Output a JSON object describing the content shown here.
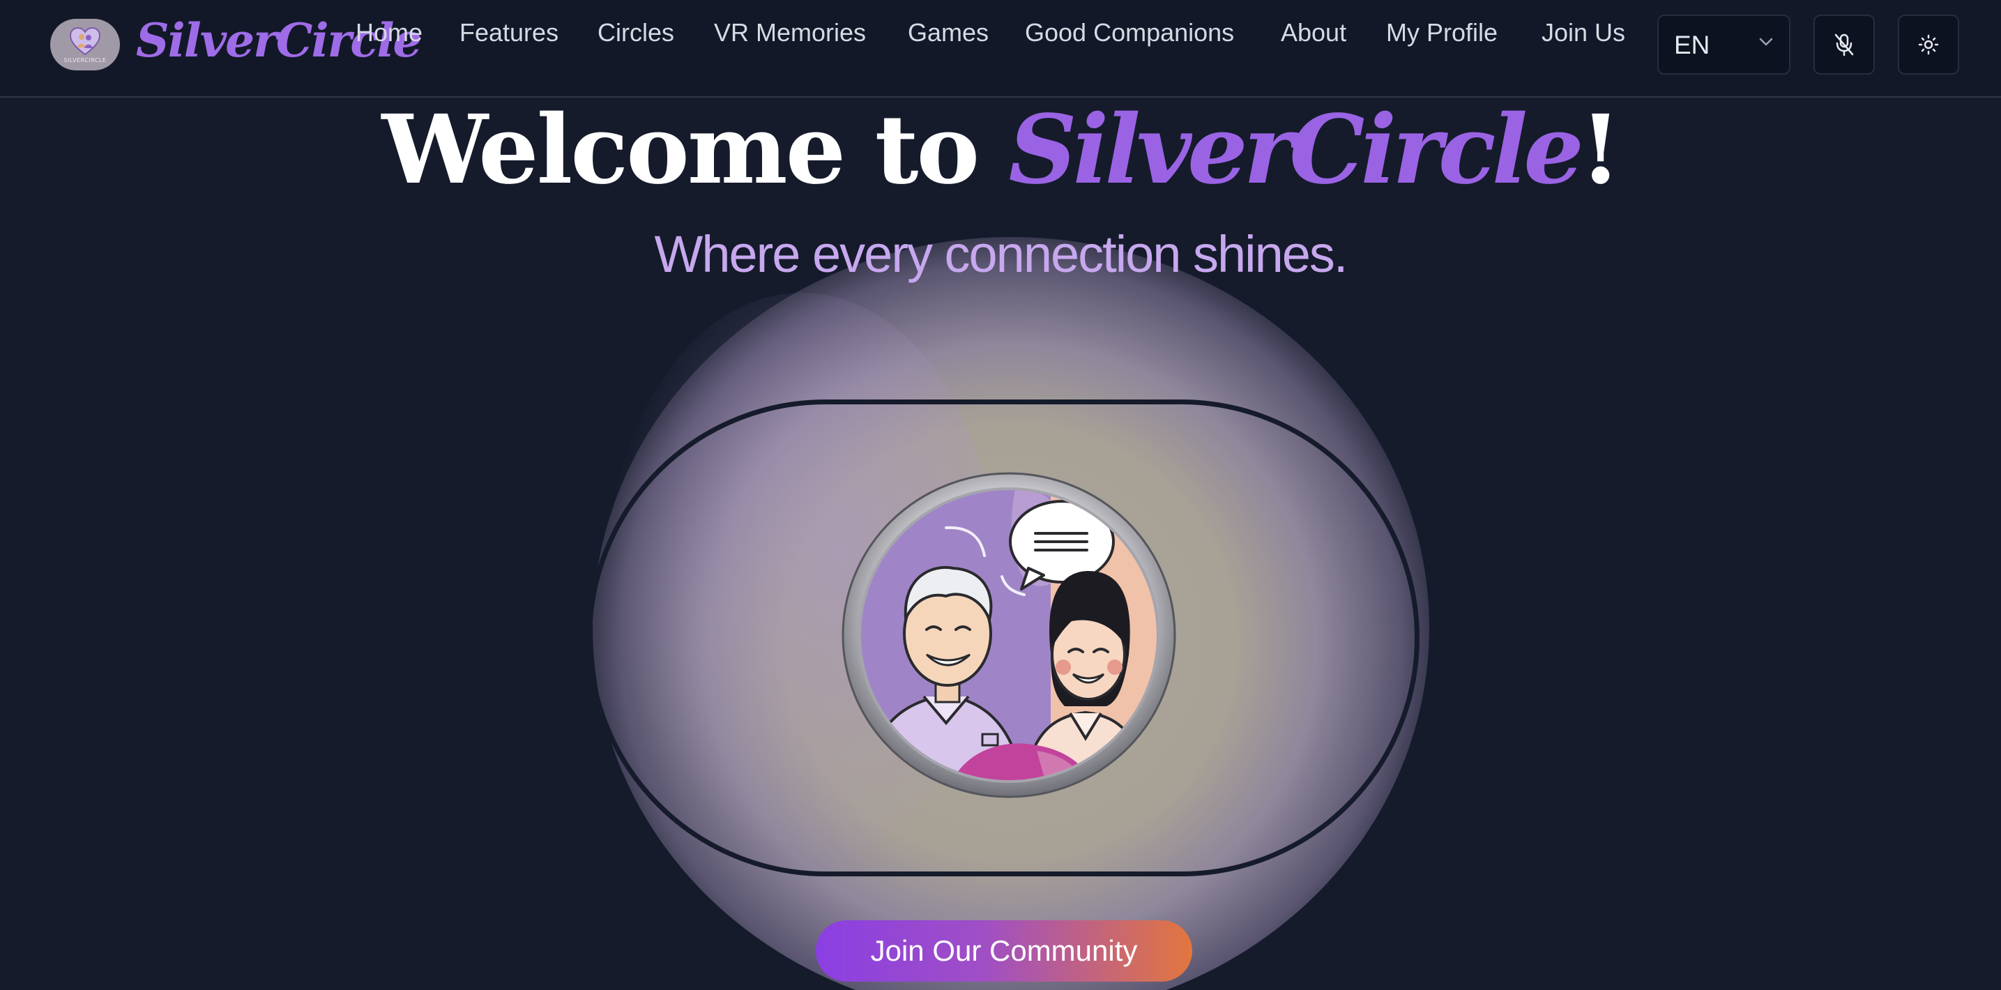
{
  "brand": {
    "name": "SilverCircle",
    "logo_caption": "SILVERCIRCLE",
    "logo_icon": "heart-people-logo-icon"
  },
  "nav": {
    "items": [
      {
        "label": "Home"
      },
      {
        "label": "Features"
      },
      {
        "label": "Circles"
      },
      {
        "label": "VR Memories"
      },
      {
        "label": "Games"
      },
      {
        "label": "Good Companions"
      },
      {
        "label": "About"
      },
      {
        "label": "My Profile"
      },
      {
        "label": "Join Us"
      }
    ]
  },
  "controls": {
    "language": "EN",
    "mic_icon": "mic-off-icon",
    "theme_icon": "sun-icon"
  },
  "hero": {
    "title_prefix": "Welcome to ",
    "title_brand": "SilverCircle",
    "title_suffix": "!",
    "tagline": "Where every connection shines.",
    "image_icon": "elderly-man-and-young-woman-chatting-illustration",
    "cta_label": "Join Our Community"
  },
  "colors": {
    "background": "#151b2b",
    "header": "#121828",
    "brand_purple": "#9f6ce8",
    "tagline": "#c7a8ee",
    "cta_start": "#8a3fe3",
    "cta_end": "#e2763e"
  }
}
